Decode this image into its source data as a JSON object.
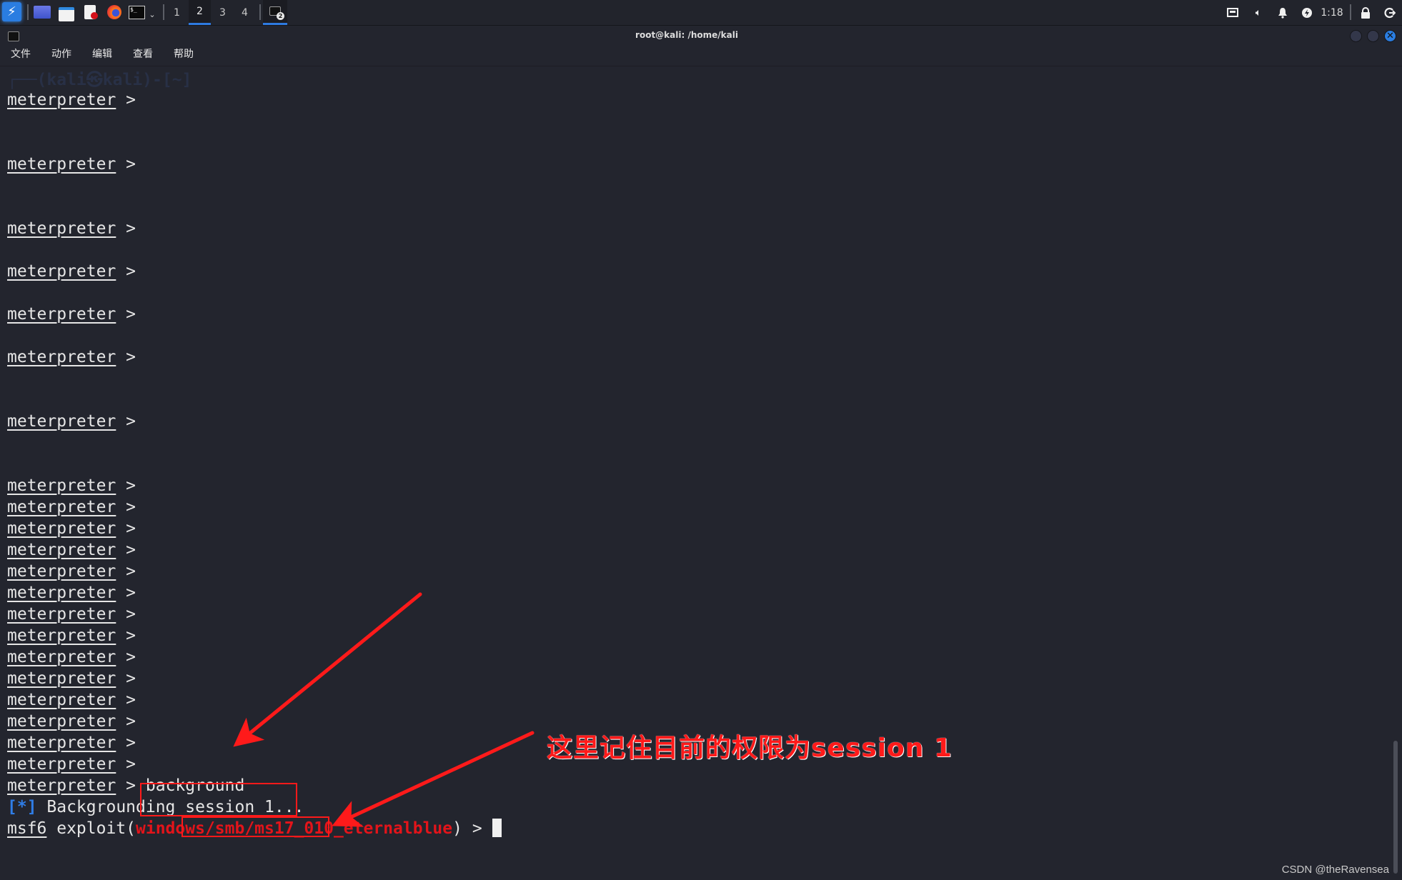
{
  "taskbar": {
    "launchers": [
      "kali-menu",
      "show-desktop",
      "file-manager",
      "text-editor",
      "firefox",
      "terminal"
    ],
    "workspaces": [
      "1",
      "2",
      "3",
      "4"
    ],
    "active_workspace": "2",
    "task_badge": "2",
    "clock": "1:18"
  },
  "window": {
    "title": "root@kali: /home/kali",
    "menu": [
      "文件",
      "动作",
      "编辑",
      "查看",
      "帮助"
    ]
  },
  "terminal": {
    "ghost_text": "┌──(kali㉿kali)-[~]",
    "meterpreter_prompt": "meterpreter",
    "prompt_suffix": " >",
    "meterpreter_rows": [
      0,
      3,
      6,
      8,
      10,
      12,
      15,
      18,
      19,
      20,
      21,
      22,
      23,
      24,
      25,
      26,
      27,
      28,
      29,
      30,
      31,
      32
    ],
    "last_command": " background",
    "info_tag": "[*]",
    "info_message": " Backgrounding session 1...",
    "msf_prompt": "msf6",
    "msf_mid": " exploit(",
    "module": "windows/smb/ms17_010_eternalblue",
    "msf_end": ") > "
  },
  "annotation": {
    "text": "这里记住目前的权限为session 1",
    "color": "#ff1a1a"
  },
  "watermark": "CSDN @theRavensea"
}
